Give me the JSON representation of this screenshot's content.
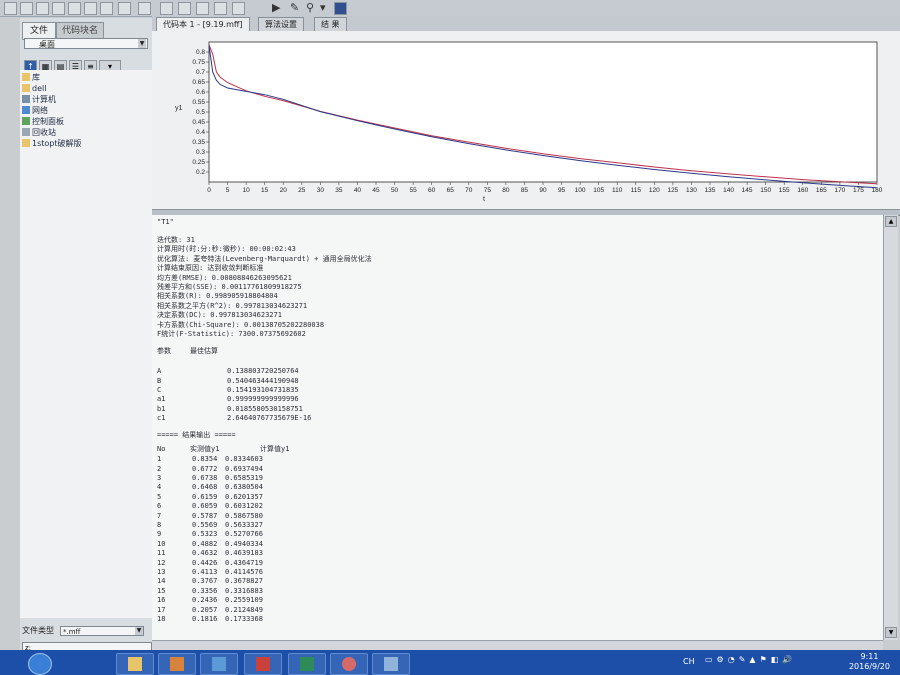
{
  "left_panel": {
    "tabs": [
      "文件",
      "代码块名"
    ],
    "location": "桌面",
    "tree": [
      "库",
      "dell",
      "计算机",
      "网络",
      "控制面板",
      "回收站",
      "1stopt破解版"
    ],
    "file_type_label": "文件类型",
    "file_type_value": "*.mff",
    "path_value": "z:"
  },
  "doc_tabs": [
    "代码本 1 - [9.19.mff]",
    "算法设置",
    "结 果"
  ],
  "chart_data": {
    "type": "line",
    "xlabel": "t",
    "ylabel": "y1",
    "xlim": [
      0,
      180
    ],
    "ylim": [
      0.15,
      0.85
    ],
    "x_ticks": [
      "0",
      "5",
      "10",
      "15",
      "20",
      "25",
      "30",
      "35",
      "40",
      "45",
      "50",
      "55",
      "60",
      "65",
      "70",
      "75",
      "80",
      "85",
      "90",
      "95",
      "100",
      "105",
      "110",
      "115",
      "120",
      "125",
      "130",
      "135",
      "140",
      "145",
      "150",
      "155",
      "160",
      "165",
      "170",
      "175",
      "180"
    ],
    "y_ticks": [
      "0.8",
      "0.75",
      "0.7",
      "0.65",
      "0.6",
      "0.55",
      "0.5",
      "0.45",
      "0.4",
      "0.35",
      "0.3",
      "0.25",
      "0.2"
    ],
    "grid": false,
    "series": [
      {
        "color": "#c0304a",
        "x": [
          0,
          1,
          2,
          3,
          5,
          10,
          15,
          20,
          30,
          40,
          50,
          60,
          70,
          80,
          90,
          100,
          110,
          120,
          130,
          140,
          150,
          160,
          170,
          180
        ],
        "values": [
          0.8354,
          0.79,
          0.7,
          0.6738,
          0.6468,
          0.6059,
          0.5787,
          0.5569,
          0.5031,
          0.4593,
          0.4202,
          0.3812,
          0.3493,
          0.3183,
          0.2912,
          0.2671,
          0.2459,
          0.2251,
          0.2067,
          0.1905,
          0.1759,
          0.1621,
          0.1511,
          0.1408
        ]
      },
      {
        "color": "#2a3a8a",
        "x": [
          0,
          1,
          2,
          3,
          5,
          10,
          15,
          20,
          30,
          40,
          50,
          60,
          70,
          80,
          90,
          100,
          110,
          120,
          130,
          140,
          150,
          160,
          170,
          180
        ],
        "values": [
          0.8334,
          0.7,
          0.6585,
          0.6381,
          0.6201,
          0.6031,
          0.5867,
          0.5633,
          0.5021,
          0.4563,
          0.4152,
          0.3765,
          0.3421,
          0.3105,
          0.2825,
          0.257,
          0.2338,
          0.2127,
          0.1936,
          0.1762,
          0.1603,
          0.1461,
          0.1331,
          0.1214
        ]
      }
    ]
  },
  "output": {
    "header": "\"T1\"",
    "summary": [
      "迭代数: 31",
      "计算用时(时:分:秒:微秒): 00:00:02:43",
      "优化算法: 麦夸特法(Levenberg-Marquardt) + 通用全局优化法",
      "计算结束原因: 达到收敛判断标准",
      "均方差(RMSE): 0.00808846263095621",
      "残差平方和(SSE): 0.00117761809918275",
      "相关系数(R): 0.998905918804804",
      "相关系数之平方(R^2): 0.997813034623271",
      "决定系数(DC): 0.997813034623271",
      "卡方系数(Chi-Square): 0.00138705202280038",
      "F统计(F-Statistic): 7300.07375692602"
    ],
    "param_header": [
      "参数",
      "最佳估算"
    ],
    "params": [
      {
        "name": "A",
        "value": "0.138803720250764"
      },
      {
        "name": "B",
        "value": "0.540463444190948"
      },
      {
        "name": "C",
        "value": "0.154193104731835"
      },
      {
        "name": "a1",
        "value": "0.999999999999996"
      },
      {
        "name": "b1",
        "value": "0.0185580530158751"
      },
      {
        "name": "c1",
        "value": "2.64640767735679E-16"
      }
    ],
    "results_title": "===== 结果输出 =====",
    "results_header": [
      "No",
      "实测值y1",
      "计算值y1"
    ],
    "results": [
      [
        "1",
        "0.8354",
        "0.8334603"
      ],
      [
        "2",
        "0.6772",
        "0.6937494"
      ],
      [
        "3",
        "0.6738",
        "0.6585319"
      ],
      [
        "4",
        "0.6468",
        "0.6380504"
      ],
      [
        "5",
        "0.6159",
        "0.6201357"
      ],
      [
        "6",
        "0.6059",
        "0.6031202"
      ],
      [
        "7",
        "0.5787",
        "0.5867580"
      ],
      [
        "8",
        "0.5569",
        "0.5633327"
      ],
      [
        "9",
        "0.5323",
        "0.5270766"
      ],
      [
        "10",
        "0.4882",
        "0.4940334"
      ],
      [
        "11",
        "0.4632",
        "0.4639183"
      ],
      [
        "12",
        "0.4426",
        "0.4364719"
      ],
      [
        "13",
        "0.4113",
        "0.4114576"
      ],
      [
        "14",
        "0.3767",
        "0.3678827"
      ],
      [
        "15",
        "0.3356",
        "0.3316883"
      ],
      [
        "16",
        "0.2436",
        "0.2559109"
      ],
      [
        "17",
        "0.2057",
        "0.2124849"
      ],
      [
        "18",
        "0.1816",
        "0.1733368"
      ]
    ]
  },
  "taskbar": {
    "lang": "CH",
    "time": "9:11",
    "date": "2016/9/20"
  },
  "colors": {
    "taskbar": "#1d4fa8",
    "series_fit": "#2a3a8a",
    "series_measured": "#c0304a"
  }
}
